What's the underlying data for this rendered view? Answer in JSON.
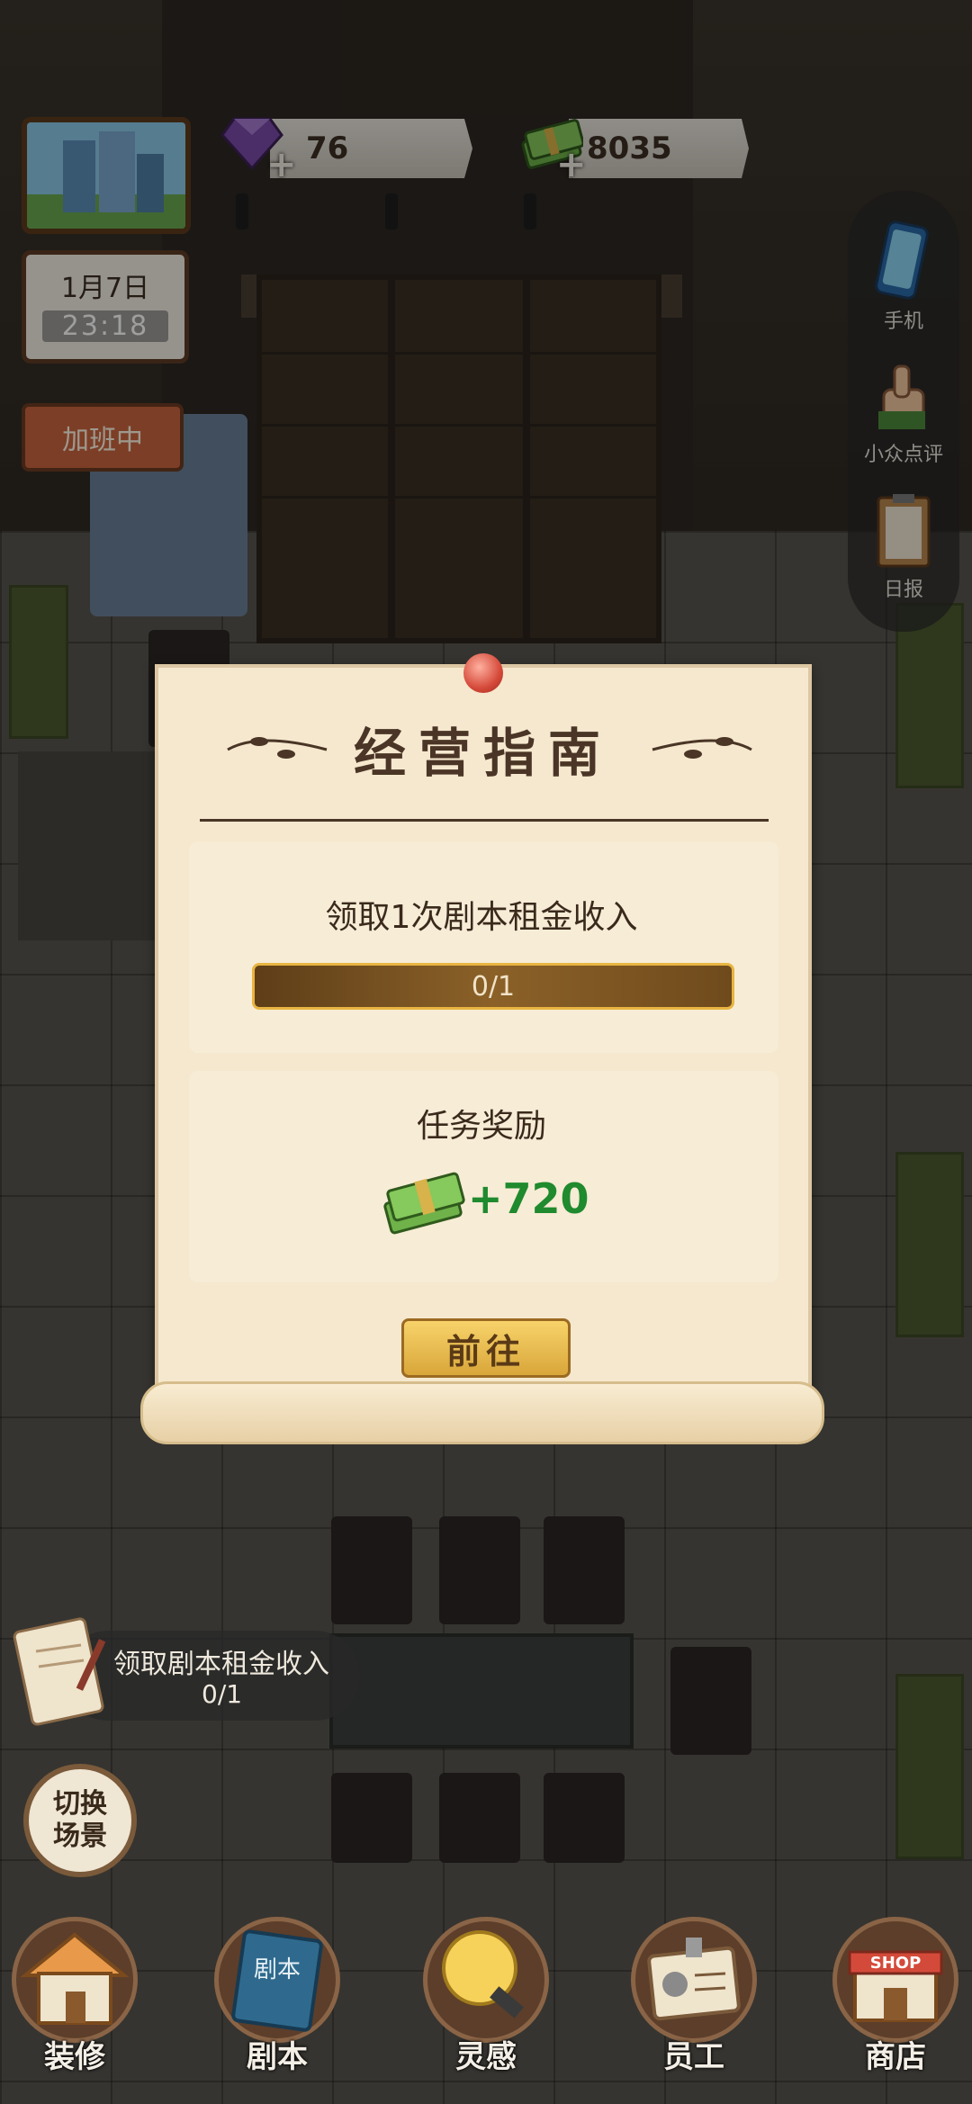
{
  "hud": {
    "gems": "76",
    "cash": "8035",
    "gem_plus": "+",
    "cash_plus": "+"
  },
  "calendar": {
    "date": "1月7日",
    "time": "23:18"
  },
  "status_sign": "加班中",
  "side_menu": [
    {
      "label": "手机",
      "icon": "phone-icon"
    },
    {
      "label": "小众点评",
      "icon": "thumbs-up-icon"
    },
    {
      "label": "日报",
      "icon": "clipboard-icon"
    }
  ],
  "modal": {
    "title": "经营指南",
    "task": "领取1次剧本租金收入",
    "progress_text": "0/1",
    "progress_value": 0,
    "reward_title": "任务奖励",
    "reward_amount": "+720",
    "go_button": "前往"
  },
  "task_reminder": {
    "text": "领取剧本租金收入",
    "count": "0/1"
  },
  "switch_scene": {
    "line1": "切换",
    "line2": "场景"
  },
  "bottom_nav": [
    {
      "label": "装修",
      "icon": "house-icon"
    },
    {
      "label": "剧本",
      "icon": "script-book-icon",
      "icon_text": "剧本"
    },
    {
      "label": "灵感",
      "icon": "lightbulb-icon"
    },
    {
      "label": "员工",
      "icon": "id-card-icon"
    },
    {
      "label": "商店",
      "icon": "shop-icon",
      "icon_text": "SHOP"
    }
  ],
  "colors": {
    "reward_green": "#1f8a2e",
    "button_gold": "#f2c75a",
    "paper": "#f5e8ce"
  }
}
